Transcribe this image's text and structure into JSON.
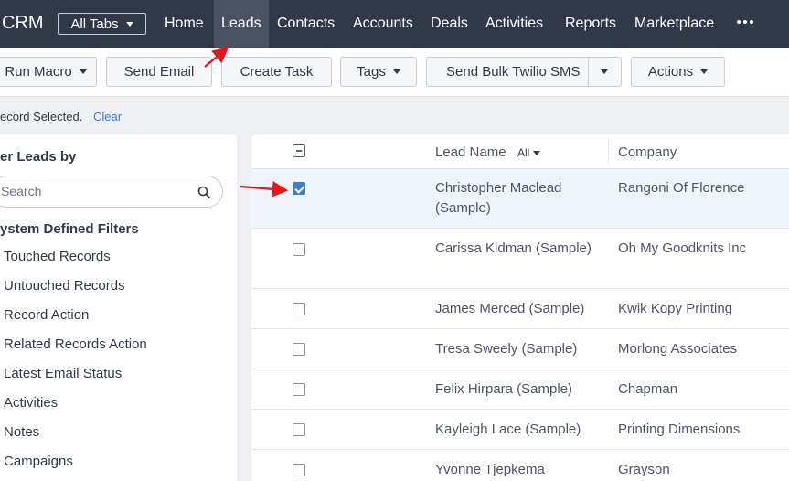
{
  "nav": {
    "brand": "CRM",
    "all_tabs": "All Tabs",
    "items": [
      "Home",
      "Leads",
      "Contacts",
      "Accounts",
      "Deals",
      "Activities",
      "Reports",
      "Marketplace"
    ],
    "active": "Leads"
  },
  "toolbar": {
    "run_macro": "Run Macro",
    "send_email": "Send Email",
    "create_task": "Create Task",
    "tags": "Tags",
    "send_bulk_sms": "Send Bulk Twilio SMS",
    "actions": "Actions"
  },
  "selection": {
    "text": "ecord Selected.",
    "clear": "Clear"
  },
  "filter": {
    "title": "er Leads by",
    "search_placeholder": "Search",
    "section_title": "ystem Defined Filters",
    "items": [
      "Touched Records",
      "Untouched Records",
      "Record Action",
      "Related Records Action",
      "Latest Email Status",
      "Activities",
      "Notes",
      "Campaigns"
    ]
  },
  "table": {
    "col_name": "Lead Name",
    "name_filter": "All",
    "col_company": "Company",
    "rows": [
      {
        "name": "Christopher Maclead (Sample)",
        "company": "Rangoni Of Florence",
        "checked": true
      },
      {
        "name": "Carissa Kidman (Sample)",
        "company": "Oh My Goodknits Inc",
        "checked": false
      },
      {
        "name": "James Merced (Sample)",
        "company": "Kwik Kopy Printing",
        "checked": false
      },
      {
        "name": "Tresa Sweely (Sample)",
        "company": "Morlong Associates",
        "checked": false
      },
      {
        "name": "Felix Hirpara (Sample)",
        "company": "Chapman",
        "checked": false
      },
      {
        "name": "Kayleigh Lace (Sample)",
        "company": "Printing Dimensions",
        "checked": false
      },
      {
        "name": "Yvonne Tjepkema (Sample)",
        "company": "Grayson",
        "checked": false
      }
    ]
  },
  "colors": {
    "nav_bg": "#313949",
    "accent": "#3f7ec8",
    "annotation": "#e8141a"
  },
  "icons": {
    "search": "search-icon",
    "more": "more-dots-icon",
    "caret": "chevron-down-icon"
  }
}
